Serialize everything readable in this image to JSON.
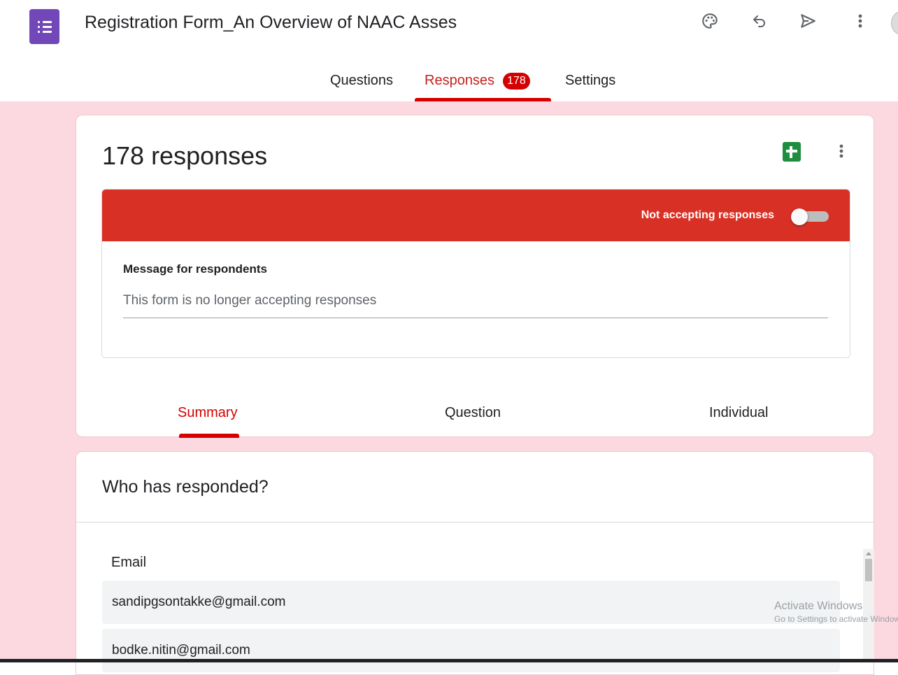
{
  "header": {
    "title": "Registration Form_An Overview of NAAC Asses",
    "icons": [
      "palette-icon",
      "undo-icon",
      "send-icon",
      "more-vert-icon",
      "avatar"
    ]
  },
  "tabs": {
    "questions": "Questions",
    "responses": "Responses",
    "responses_count": "178",
    "settings": "Settings"
  },
  "summary_card": {
    "title": "178 responses",
    "accepting_label": "Not accepting responses",
    "accepting_on": false,
    "message_label": "Message for respondents",
    "message_value": "This form is no longer accepting responses"
  },
  "subtabs": {
    "summary": "Summary",
    "question": "Question",
    "individual": "Individual"
  },
  "respondents_card": {
    "title": "Who has responded?",
    "column": "Email",
    "rows": [
      "sandipgsontakke@gmail.com",
      "bodke.nitin@gmail.com"
    ]
  },
  "watermark": {
    "line1": "Activate Windows",
    "line2": "Go to Settings to activate Windows."
  },
  "colors": {
    "brand": "#7248b9",
    "accent": "#d50000",
    "banner": "#d93025",
    "background": "#fcd9e0",
    "sheets": "#1e8e3e"
  }
}
